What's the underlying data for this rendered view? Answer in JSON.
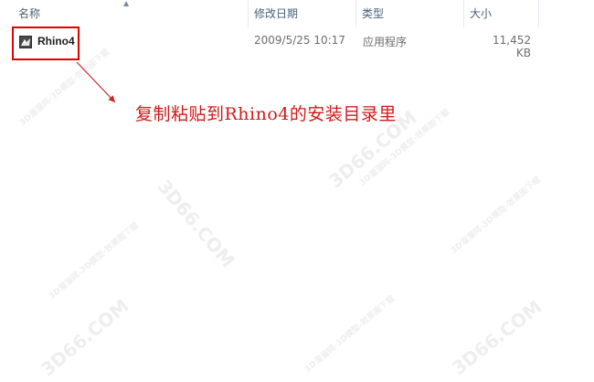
{
  "columns": {
    "name": "名称",
    "date": "修改日期",
    "type": "类型",
    "size": "大小"
  },
  "file": {
    "name": "Rhino4",
    "date": "2009/5/25 10:17",
    "type": "应用程序",
    "size": "11,452 KB",
    "icon": "rhino-app-icon"
  },
  "annotation": {
    "text": "复制粘贴到Rhino4的安装目录里",
    "color": "#d11a1a"
  },
  "watermarks": {
    "site": "3D66.COM",
    "slogan": "3D溜溜网-3D模型-效果图下载"
  },
  "colors": {
    "highlight_border": "#e10000",
    "header_text": "#4c607a"
  }
}
